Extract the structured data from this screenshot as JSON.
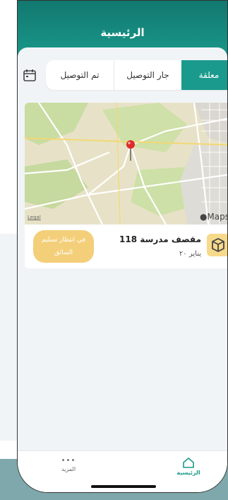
{
  "header": {
    "title": "الرئيسية"
  },
  "tabs": [
    {
      "label": "معلقة",
      "active": true
    },
    {
      "label": "جار التوصيل",
      "active": false
    },
    {
      "label": "تم التوصيل",
      "active": false
    }
  ],
  "map": {
    "legal_label": "Legal",
    "maps_label": "Maps",
    "icon": "map-pin-icon"
  },
  "order": {
    "name": "مقصف مدرسة 118",
    "date": "يناير ٢٠",
    "status": [
      "في انتظار تسليم",
      "السائق"
    ],
    "icon": "package-icon"
  },
  "nav": {
    "home_label": "الرئيسية",
    "more_label": "المزيد",
    "more_icon_glyph": "•••"
  },
  "colors": {
    "brand": "#1a9a8c",
    "status_pending": "#f4cf7a"
  }
}
